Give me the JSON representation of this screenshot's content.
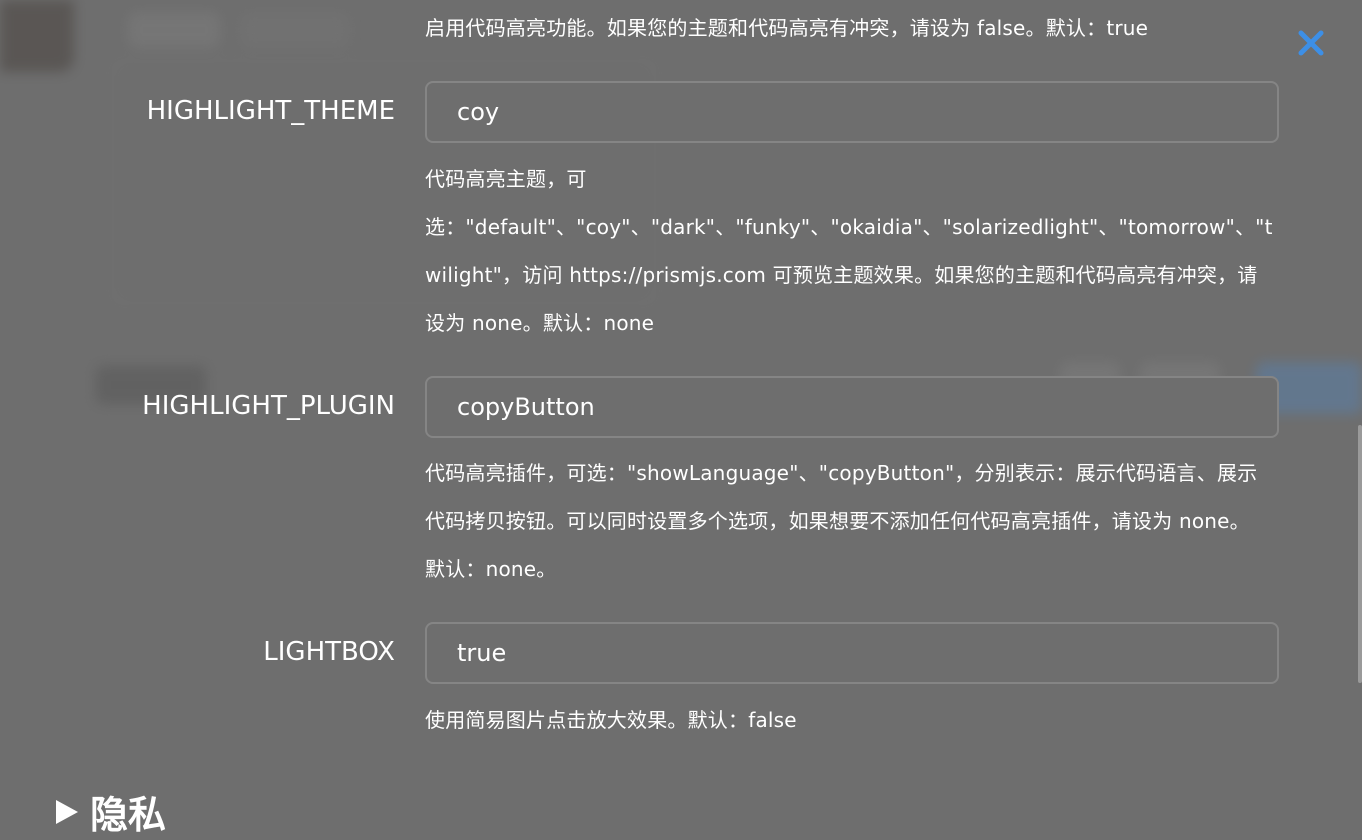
{
  "top_description": "启用代码高亮功能。如果您的主题和代码高亮有冲突，请设为 false。默认：true",
  "fields": [
    {
      "label": "HIGHLIGHT_THEME",
      "value": "coy",
      "description_lines": [
        "代码高亮主题，可",
        "选：\"default\"、\"coy\"、\"dark\"、\"funky\"、\"okaidia\"、\"solarizedlight\"、\"tomorrow\"、\"t",
        "wilight\"，访问 https://prismjs.com 可预览主题效果。如果您的主题和代码高亮有冲突，请",
        "设为 none。默认：none"
      ]
    },
    {
      "label": "HIGHLIGHT_PLUGIN",
      "value": "copyButton",
      "description_lines": [
        "代码高亮插件，可选：\"showLanguage\"、\"copyButton\"，分别表示：展示代码语言、展示",
        "代码拷贝按钮。可以同时设置多个选项，如果想要不添加任何代码高亮插件，请设为 none。",
        "默认：none。"
      ]
    },
    {
      "label": "LIGHTBOX",
      "value": "true",
      "description_lines": [
        "使用简易图片点击放大效果。默认：false"
      ]
    }
  ],
  "section": {
    "label": "隐私"
  },
  "colors": {
    "overlay": "#6e6e6e",
    "close_icon": "#3d8fe6",
    "text": "#ffffff",
    "field_border": "#858585"
  },
  "icons": {
    "close": "close-icon",
    "expand": "triangle-right-icon"
  }
}
